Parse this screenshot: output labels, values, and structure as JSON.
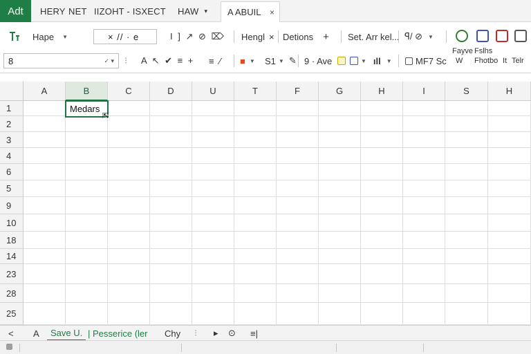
{
  "tabbar": {
    "app_tab": "Adt",
    "menus": [
      "HERY",
      "NET",
      "IIZOHT - ISXECT",
      "HAW"
    ],
    "doc_tab": "A ABUIL",
    "close_glyph": "×"
  },
  "ribbon": {
    "style_label": "Hape",
    "format_tools": "×  //  ·  e",
    "bracket_tools": "I  ]  ↗  ⊘  ⌦",
    "group1": "Hengl",
    "group1_close": "×",
    "group2": "Detions",
    "group2_add": "+",
    "group3": "Set. Arr kel...",
    "group4": "ꟼ/ ⊘",
    "name_box_value": "8",
    "row2_tools": "A  ↖  ✔  ≡  +",
    "row2_tools2": "≡  ⁄",
    "st_label": "S1",
    "fx_label": "9 · Ave",
    "mf_label": "MF7 Sc",
    "right_top": [
      "Fayve",
      "Fslhs"
    ],
    "right_bottom": [
      "W",
      "Fhotbo",
      "It",
      "Telr"
    ]
  },
  "sheet": {
    "columns": [
      "A",
      "B",
      "C",
      "D",
      "U",
      "T",
      "F",
      "G",
      "H",
      "I",
      "S",
      "H"
    ],
    "selected_column": "B",
    "rows": [
      "1",
      "2",
      "3",
      "4",
      "6",
      "5",
      "9",
      "10",
      "18",
      "14",
      "23",
      "28",
      "25"
    ],
    "active_cell": {
      "column": "B",
      "row": "1",
      "value": "Medars"
    }
  },
  "sheet_tabs": {
    "nav_prev": "<",
    "tabs": [
      "A",
      "Save U.",
      "Pesserice (ler",
      "Chy"
    ],
    "active_tab": "Save U.",
    "nav_next": "▸",
    "extra": [
      "⊙",
      "≡|"
    ]
  },
  "colors": {
    "accent": "#1e7e45",
    "selection": "#217346",
    "header_bg": "#f3f3f3",
    "gridline": "#dedede"
  },
  "icons": {
    "style_icon": "text-style-icon",
    "dropdown_icon": "chevron-down-icon",
    "table_icon": "table-icon"
  }
}
